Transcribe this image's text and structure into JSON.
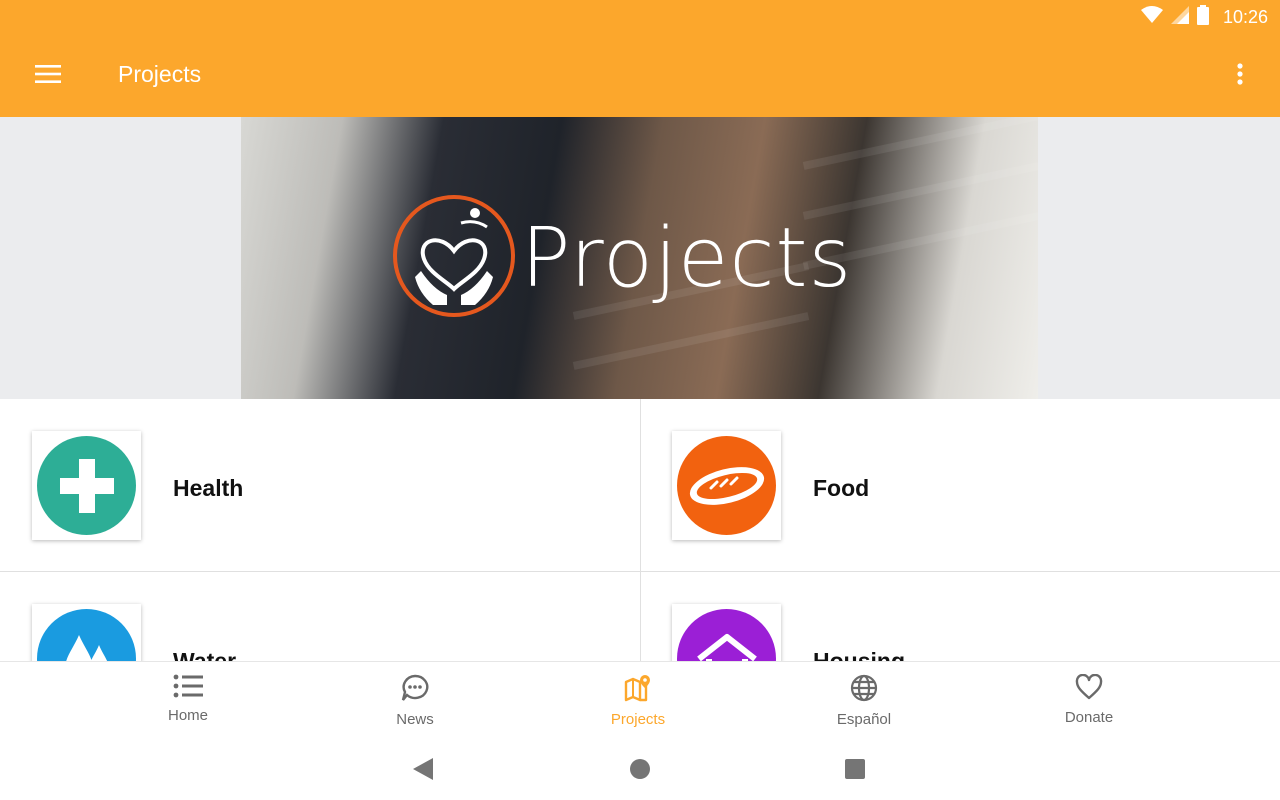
{
  "status_bar": {
    "time": "10:26"
  },
  "app_bar": {
    "title": "Projects"
  },
  "banner": {
    "title": "Projects"
  },
  "projects": [
    {
      "label": "Health",
      "icon": "medical-cross-icon",
      "color": "#2DAE96"
    },
    {
      "label": "Food",
      "icon": "bread-icon",
      "color": "#F2620F"
    },
    {
      "label": "Water",
      "icon": "water-drops-icon",
      "color": "#1A9BE0"
    },
    {
      "label": "Housing",
      "icon": "house-icon",
      "color": "#9B1FD6"
    }
  ],
  "bottom_nav": {
    "items": [
      {
        "label": "Home",
        "icon": "list-icon"
      },
      {
        "label": "News",
        "icon": "chat-bubble-icon"
      },
      {
        "label": "Projects",
        "icon": "map-pin-icon",
        "active": true
      },
      {
        "label": "Español",
        "icon": "globe-icon"
      },
      {
        "label": "Donate",
        "icon": "heart-icon"
      }
    ]
  },
  "colors": {
    "accent": "#FCA72C",
    "inactive": "#6A6A6A"
  }
}
